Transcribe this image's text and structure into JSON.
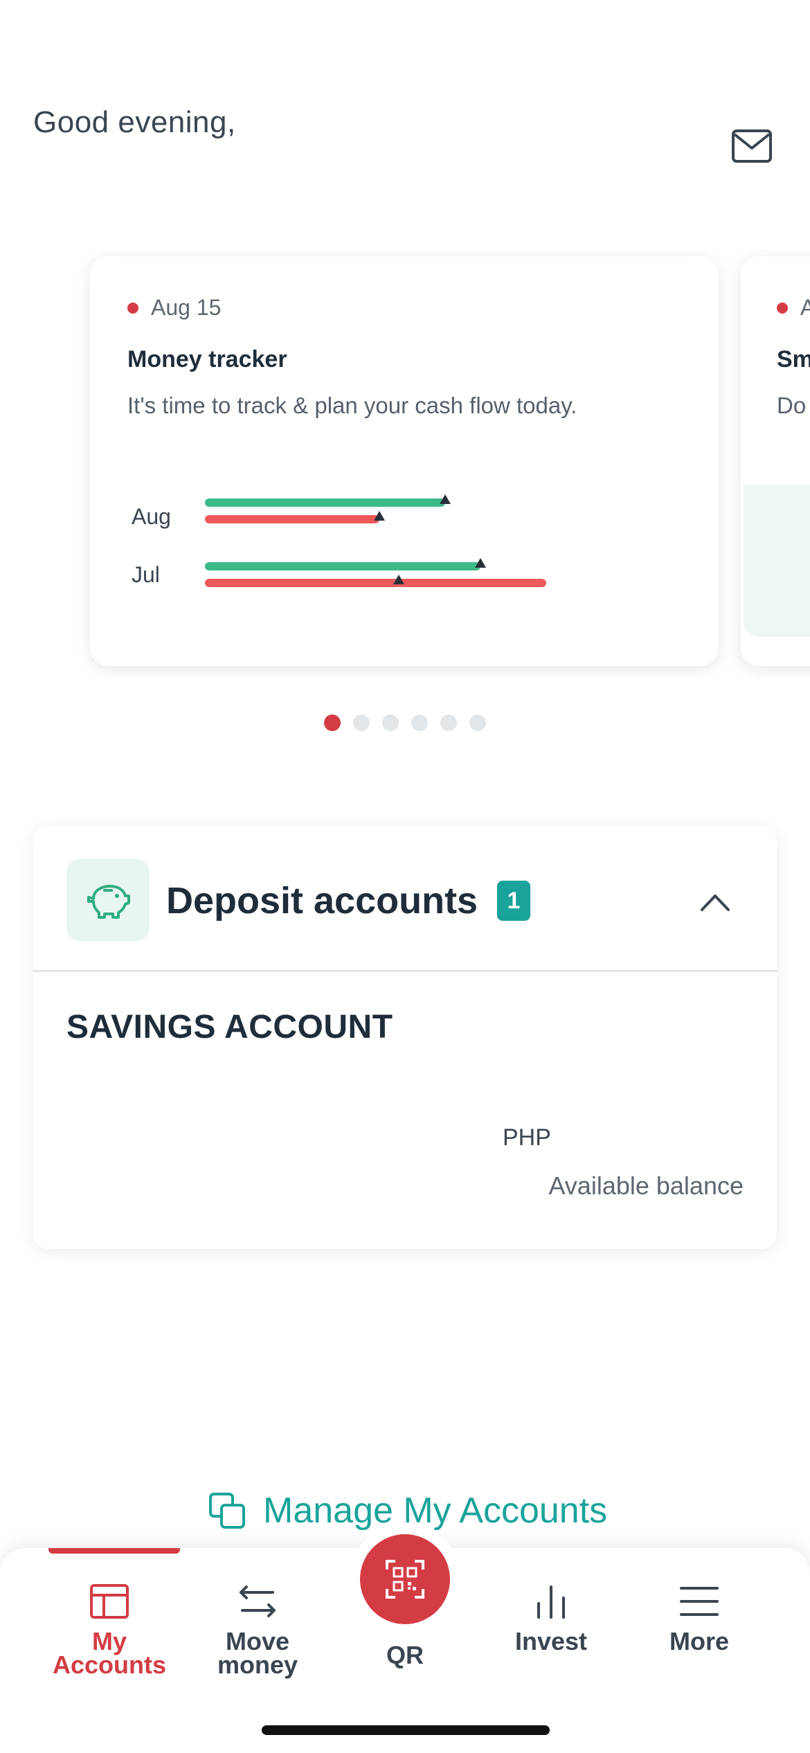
{
  "header": {
    "greeting": "Good evening,",
    "mail_icon": "envelope-icon"
  },
  "carousel": {
    "cards": [
      {
        "date": "Aug 15",
        "title": "Money tracker",
        "description": "It's time to track & plan your cash flow today.",
        "tracker": {
          "months": [
            {
              "label": "Aug",
              "inflow": 0.62,
              "outflow": 0.45
            },
            {
              "label": "Jul",
              "inflow": 0.71,
              "outflow": 0.88
            }
          ]
        }
      },
      {
        "date": "A",
        "title": "Sm",
        "description": "Do app"
      }
    ],
    "page_count": 6,
    "active_page": 0
  },
  "deposit": {
    "title": "Deposit accounts",
    "count": "1",
    "account_type": "SAVINGS ACCOUNT",
    "currency": "PHP",
    "balance_label": "Available balance"
  },
  "manage": {
    "label": "Manage My Accounts"
  },
  "nav": {
    "items": [
      {
        "label": "My\nAccounts",
        "icon": "layout-icon",
        "active": true
      },
      {
        "label": "Move\nmoney",
        "icon": "transfer-arrows-icon",
        "active": false
      },
      {
        "label": "Invest",
        "icon": "bar-chart-icon",
        "active": false
      },
      {
        "label": "More",
        "icon": "menu-icon",
        "active": false
      }
    ],
    "qr_label": "QR"
  },
  "colors": {
    "accent_red": "#d43c43",
    "teal": "#1aa39b",
    "green_bar": "#3dba8a",
    "red_bar": "#ee5a5c"
  }
}
